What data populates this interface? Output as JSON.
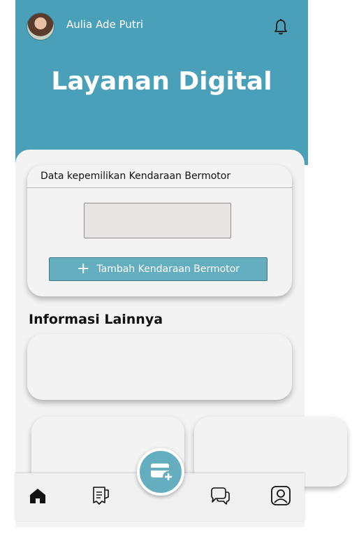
{
  "header": {
    "user_name": "Aulia Ade Putri",
    "title": "Layanan Digital"
  },
  "vehicle_card": {
    "title": "Data kepemilikan Kendaraan Bermotor",
    "add_button_label": "Tambah Kendaraan Bermotor"
  },
  "info_section": {
    "title": "Informasi Lainnya"
  },
  "bottom_nav": {
    "items": [
      "home-icon",
      "receipt-icon",
      "add-card-icon",
      "chat-icon",
      "profile-icon"
    ]
  },
  "colors": {
    "primary": "#4aa0b8",
    "button": "#64aec0",
    "surface": "#f3f3f3"
  }
}
